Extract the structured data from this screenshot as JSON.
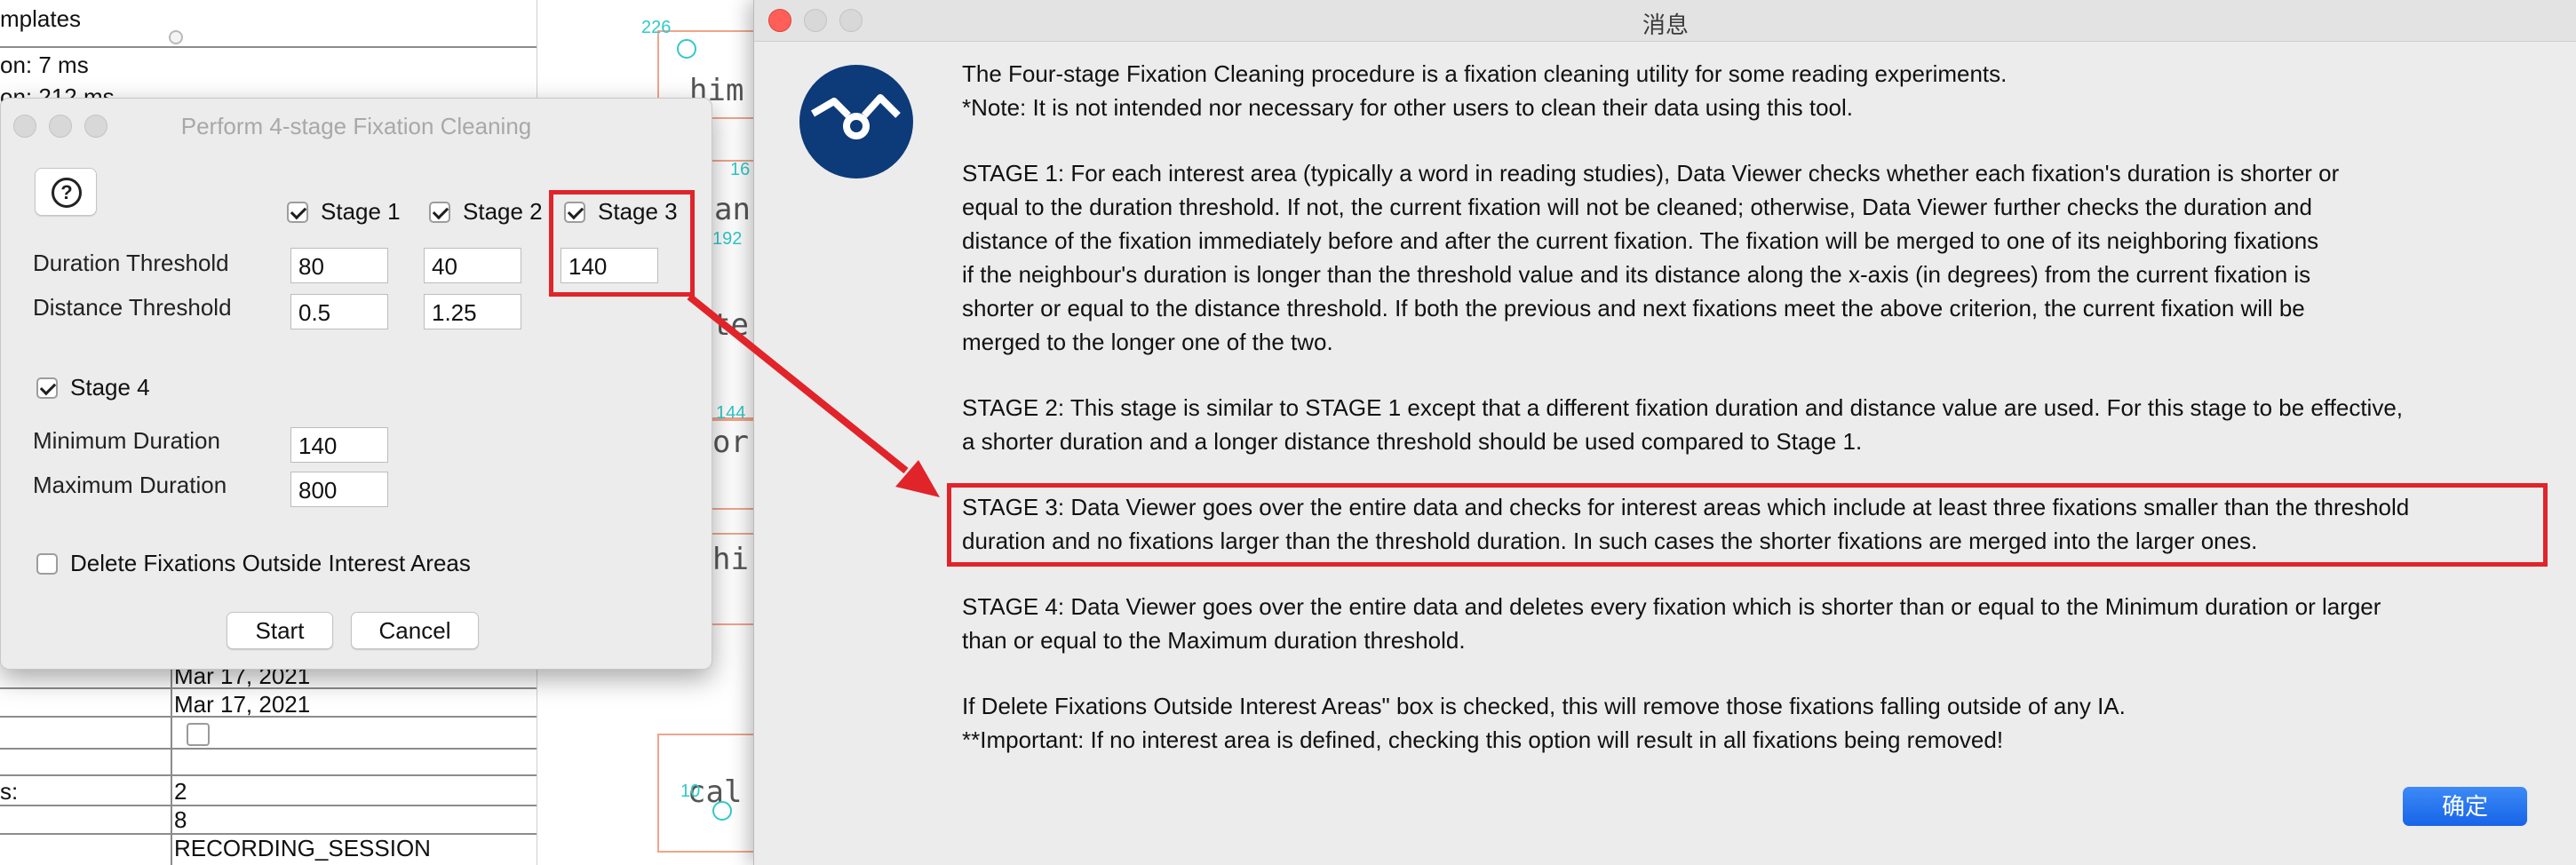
{
  "background_panel": {
    "top_fragments": [
      "mplates",
      "on: 7 ms",
      "on: 212 ms"
    ],
    "rows": [
      {
        "label": "",
        "value": "Mar 17, 2021"
      },
      {
        "label": "",
        "value": "Mar 17, 2021"
      },
      {
        "label": "",
        "value": ""
      },
      {
        "label": "",
        "value": ""
      },
      {
        "label": "s:",
        "value": "2"
      },
      {
        "label": "",
        "value": "8"
      },
      {
        "label": "",
        "value": "RECORDING_SESSION"
      }
    ]
  },
  "canvas": {
    "words": [
      "him",
      "an",
      "te",
      "or",
      "hi",
      "cal"
    ],
    "fixation_numbers": [
      "226",
      "16",
      "192",
      "144",
      "16",
      "10"
    ]
  },
  "stage_dialog": {
    "title": "Perform 4-stage Fixation Cleaning",
    "help_glyph": "?",
    "stage1_label": "Stage 1",
    "stage2_label": "Stage 2",
    "stage3_label": "Stage 3",
    "stage1_checked": true,
    "stage2_checked": true,
    "stage3_checked": true,
    "duration_label": "Duration Threshold",
    "distance_label": "Distance Threshold",
    "duration_values": [
      "80",
      "40",
      "140"
    ],
    "distance_values": [
      "0.5",
      "1.25"
    ],
    "stage4_label": "Stage 4",
    "stage4_checked": true,
    "min_duration_label": "Minimum Duration",
    "min_duration_value": "140",
    "max_duration_label": "Maximum Duration",
    "max_duration_value": "800",
    "delete_label": "Delete Fixations Outside Interest Areas",
    "delete_checked": false,
    "start_label": "Start",
    "cancel_label": "Cancel"
  },
  "message_dialog": {
    "title": "消息",
    "lines": [
      "The Four-stage Fixation Cleaning procedure is a fixation cleaning utility for some reading experiments.",
      "*Note: It is not intended nor necessary for other users to clean their data using this tool.",
      "STAGE 1: For each interest area (typically a word in reading studies), Data Viewer checks whether each fixation's duration is shorter or",
      "equal to the duration threshold. If not, the current fixation will not be cleaned; otherwise, Data Viewer further checks the duration and",
      "distance of the fixation immediately before and after the current fixation. The fixation will be merged to one of its neighboring fixations",
      "if the neighbour's duration is longer than the threshold value and its distance along the x-axis (in degrees) from the current fixation is",
      "shorter or equal to the distance threshold. If both the previous and next fixations meet the above criterion, the current fixation will be",
      "merged to the longer one of the two.",
      "STAGE 2: This stage is similar to STAGE 1 except that a different fixation duration and distance value are used. For this stage to be effective,",
      "a shorter duration and a longer distance threshold should be used compared to Stage 1.",
      "STAGE 3: Data Viewer goes over the entire data and checks for interest areas which include at least three fixations smaller than the threshold",
      "duration and no fixations larger than the threshold duration. In such cases the shorter fixations are merged into the larger ones.",
      "STAGE 4: Data Viewer goes over the entire data and deletes every fixation which is shorter than or equal to the Minimum duration or larger",
      "than or equal to the Maximum duration threshold.",
      "If Delete Fixations Outside Interest Areas\" box is checked, this will remove those fixations falling outside of any IA.",
      "**Important: If no interest area is defined, checking this option will result in all fixations being removed!"
    ],
    "ok_label": "确定"
  },
  "colors": {
    "annotation_red": "#e0242a",
    "logo_blue": "#0d3a78",
    "ok_blue": "#1f6ff0",
    "fixation_cyan": "#31c9c9",
    "ia_box": "#f0a58c"
  }
}
